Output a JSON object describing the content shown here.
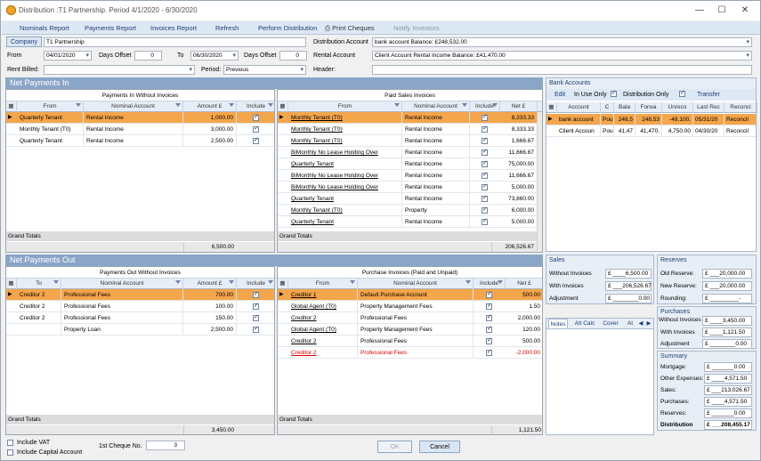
{
  "window": {
    "title": "Distribution :T1 Partnership. Period 4/1/2020 - 6/30/2020",
    "minimize": "—",
    "maximize": "☐",
    "close": "✕"
  },
  "menu": {
    "nominals": "Nominals Report",
    "payments": "Payments Report",
    "invoices": "Invoices Report",
    "refresh": "Refresh",
    "perform": "Perform Distribution",
    "print": "Print Cheques",
    "notify": "Notify Investors"
  },
  "filters": {
    "company_btn": "Company",
    "company": "T1 Partnership",
    "from_label": "From",
    "from": "04/01/2020",
    "days_offset_label": "Days Offset",
    "days_offset_1": "0",
    "to_label": "To",
    "to": "06/30/2020",
    "days_offset_2": "0",
    "rent_billed_label": "Rent Billed:",
    "rent_billed": "",
    "period_label": "Period:",
    "period": "Previous",
    "dist_account_label": "Distribution Account",
    "dist_account": "bank account   Balance: £248,532.00",
    "rental_account_label": "Rental Account",
    "rental_account": "Client Account Rental Income   Balance: £41,470.00",
    "header_label": "Header:",
    "header": ""
  },
  "net_in": {
    "title": "Net Payments In",
    "pwi": {
      "title": "Payments In Without Invoices",
      "cols": [
        "From",
        "Nominal Account",
        "Amount £",
        "Include"
      ],
      "rows": [
        {
          "from": "Quarterly Tenant",
          "nominal": "Rental Income",
          "amount": "1,000.00",
          "include": true
        },
        {
          "from": "Monthly Tenant (T0)",
          "nominal": "Rental Income",
          "amount": "3,000.00",
          "include": true
        },
        {
          "from": "Quarterly Tenant",
          "nominal": "Rental Income",
          "amount": "2,500.00",
          "include": true
        }
      ],
      "grand_totals": "Grand Totals",
      "total": "6,500.00"
    },
    "psi": {
      "title": "Paid Sales Invoices",
      "cols": [
        "From",
        "Nominal Account",
        "Include",
        "Net £"
      ],
      "rows": [
        {
          "from": "Monthly Tenant (T0)",
          "nominal": "Rental Income",
          "net": "8,333.33"
        },
        {
          "from": "Monthly Tenant (T0)",
          "nominal": "Rental Income",
          "net": "8,333.33"
        },
        {
          "from": "Monthly Tenant (T0)",
          "nominal": "Rental Income",
          "net": "1,666.67"
        },
        {
          "from": "BiMonthly No Lease Holding Over",
          "nominal": "Rental Income",
          "net": "11,666.67"
        },
        {
          "from": "Quarterly Tenant",
          "nominal": "Rental Income",
          "net": "75,000.00"
        },
        {
          "from": "BiMonthly No Lease Holding Over",
          "nominal": "Rental Income",
          "net": "11,666.67"
        },
        {
          "from": "BiMonthly No Lease Holding Over",
          "nominal": "Rental Income",
          "net": "5,000.00"
        },
        {
          "from": "Quarterly Tenant",
          "nominal": "Rental Income",
          "net": "73,860.00"
        },
        {
          "from": "Monthly Tenant (T0)",
          "nominal": "Property",
          "net": "6,000.00"
        },
        {
          "from": "Quarterly Tenant",
          "nominal": "Rental Income",
          "net": "5,000.00"
        }
      ],
      "grand_totals": "Grand Totals",
      "total": "206,526.67"
    }
  },
  "net_out": {
    "title": "Net Payments Out",
    "pwo": {
      "title": "Payments Out Without Invoices",
      "cols": [
        "To",
        "Nominal Account",
        "Amount £",
        "Include"
      ],
      "rows": [
        {
          "to": "Creditor 2",
          "nominal": "Professional Fees",
          "amount": "700.00",
          "include": true
        },
        {
          "to": "Creditor 2",
          "nominal": "Professional Fees",
          "amount": "100.00",
          "include": true
        },
        {
          "to": "Creditor 2",
          "nominal": "Professional Fees",
          "amount": "150.00",
          "include": true
        },
        {
          "to": "",
          "nominal": "Property Loan",
          "amount": "2,500.00",
          "include": true
        }
      ],
      "grand_totals": "Grand Totals",
      "total": "3,450.00"
    },
    "pi": {
      "title": "Purchase Invoices (Paid and Unpaid)",
      "cols": [
        "From",
        "Nominal Account",
        "Include",
        "Net £"
      ],
      "rows": [
        {
          "from": "Creditor 1",
          "nominal": "Default Purchase Account",
          "net": "500.00",
          "red": false
        },
        {
          "from": "Global Agent (T0)",
          "nominal": "Property Management Fees",
          "net": "1.50",
          "red": false
        },
        {
          "from": "Creditor 2",
          "nominal": "Professional Fees",
          "net": "2,000.00",
          "red": false
        },
        {
          "from": "Global Agent (T0)",
          "nominal": "Property Management Fees",
          "net": "120.00",
          "red": false
        },
        {
          "from": "Creditor 2",
          "nominal": "Professional Fees",
          "net": "500.00",
          "red": false
        },
        {
          "from": "Creditor 2",
          "nominal": "Professional Fees",
          "net": "-2,000.00",
          "red": true
        }
      ],
      "grand_totals": "Grand Totals",
      "total": "1,121.50"
    }
  },
  "bank": {
    "title": "Bank Accounts",
    "edit": "Edit",
    "in_use": "In Use Only",
    "dist_only": "Distribution Only",
    "transfer": "Transfer",
    "cols": [
      "Account",
      "C",
      "Bala",
      "Forwa",
      "Unreco",
      "Last Rec",
      "Reconci"
    ],
    "rows": [
      [
        "bank account",
        "Pou",
        "248,5",
        "248,53",
        "-48,100.",
        "05/31/20",
        "Reconcil"
      ],
      [
        "Client Accoun",
        "Pou",
        "41,47",
        "41,470.",
        "4,750.00",
        "04/30/20",
        "Reconcil"
      ]
    ]
  },
  "sales": {
    "title": "Sales",
    "without_label": "Without Invoices",
    "without": "£ ____6,500.00",
    "with_label": "With Invoices",
    "with": "£ ___206,526.67",
    "adj_label": "Adjustment",
    "adj": "£ ________0.00"
  },
  "tabs": [
    "Notes",
    "Alt Calc",
    "Cover",
    "At"
  ],
  "reserves": {
    "title": "Reserves",
    "old_label": "Old Reserve:",
    "old": "£ ___20,000.00",
    "new_label": "New Reserve:",
    "new": "£ ___20,000.00",
    "round_label": "Rounding:",
    "round": "£ _________-"
  },
  "purchases": {
    "title": "Purchases",
    "without_label": "Without Invoices",
    "without": "£ ____3,450.00",
    "with_label": "With Invoices",
    "with": "£ ____1,121.50",
    "adj_label": "Adjustment",
    "adj": "£ ________0.00"
  },
  "summary": {
    "title": "Summary",
    "mortgage_label": "Mortgage:",
    "mortgage": "£ _______0.00",
    "other_label": "Other Expenses:",
    "other": "£ ____4,571.50",
    "sales_label": "Sales:",
    "sales": "£ ___213,026.67",
    "purch_label": "Purchases:",
    "purch": "£ ____4,571.50",
    "res_label": "Reserves:",
    "res": "£ _______0.00",
    "dist_label": "Distribution",
    "dist": "£ ___208,455.17"
  },
  "footer": {
    "vat": "Include VAT",
    "cap": "Include Capital Account",
    "cheque_label": "1st Cheque No.",
    "cheque": "3",
    "ok": "OK",
    "cancel": "Cancel"
  }
}
